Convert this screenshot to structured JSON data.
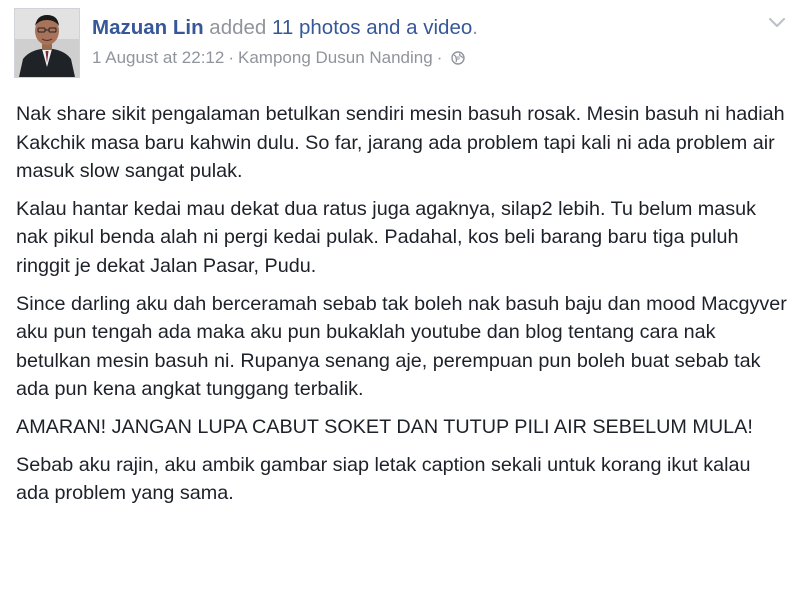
{
  "post": {
    "author": "Mazuan Lin",
    "action_prefix": " added ",
    "action_link": "11 photos and a video",
    "action_suffix": ".",
    "timestamp": "1 August at 22:12",
    "separator": "·",
    "location": "Kampong Dusun Nanding",
    "privacy_icon": "globe-icon",
    "menu_icon": "chevron-down-icon",
    "paragraphs": [
      "Nak share sikit pengalaman betulkan sendiri mesin basuh rosak. Mesin basuh ni hadiah Kakchik masa baru kahwin dulu. So far, jarang ada problem tapi kali ni ada problem air masuk slow sangat pulak.",
      "Kalau hantar kedai mau dekat dua ratus juga agaknya, silap2 lebih. Tu belum masuk nak pikul benda alah ni pergi kedai pulak. Padahal, kos beli barang baru tiga puluh ringgit je dekat Jalan Pasar, Pudu.",
      "Since darling aku dah berceramah sebab tak boleh nak basuh baju dan mood Macgyver aku pun tengah ada maka aku pun bukaklah youtube dan blog tentang cara nak betulkan mesin basuh ni. Rupanya senang aje, perempuan pun boleh buat sebab tak ada pun kena angkat tunggang terbalik.",
      "AMARAN! JANGAN LUPA CABUT SOKET DAN TUTUP PILI AIR SEBELUM MULA!",
      "Sebab aku rajin, aku ambik gambar siap letak caption sekali untuk korang ikut kalau ada problem yang sama."
    ]
  },
  "colors": {
    "link": "#365899",
    "meta": "#90949c",
    "text": "#1d2129"
  }
}
